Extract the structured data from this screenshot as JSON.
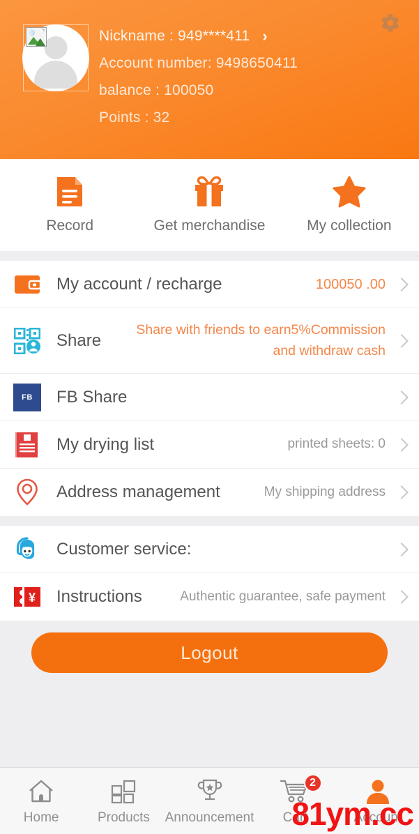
{
  "header": {
    "gear_icon": "gear-icon",
    "avatar_icon": "broken-image-placeholder",
    "nickname_label": "Nickname : 949****411",
    "chevron": "›",
    "account_label": "Account number:   9498650411",
    "balance_label": "balance : 100050",
    "points_label": "Points : 32",
    "bg_color": "#f97812"
  },
  "quick_actions": [
    {
      "icon": "document-icon",
      "label": "Record"
    },
    {
      "icon": "gift-icon",
      "label": "Get merchandise"
    },
    {
      "icon": "star-icon",
      "label": "My collection"
    }
  ],
  "menu_group_1": [
    {
      "icon": "wallet-icon",
      "label": "My account / recharge",
      "value": "100050 .00",
      "value_style": "amount"
    },
    {
      "icon": "qr-share-icon",
      "label": "Share",
      "value": "Share with friends to earn5%Commission and withdraw cash",
      "value_style": "accent"
    },
    {
      "icon": "fb-icon",
      "label": "FB Share",
      "value": "",
      "value_style": ""
    },
    {
      "icon": "receipt-icon",
      "label": "My drying list",
      "value": "printed sheets: 0",
      "value_style": ""
    },
    {
      "icon": "location-pin-icon",
      "label": "Address management",
      "value": "My shipping address",
      "value_style": ""
    }
  ],
  "menu_group_2": [
    {
      "icon": "headset-support-icon",
      "label": "Customer service:",
      "value": "",
      "value_style": ""
    },
    {
      "icon": "coupon-yen-icon",
      "label": "Instructions",
      "value": "Authentic guarantee, safe payment",
      "value_style": ""
    }
  ],
  "logout": {
    "label": "Logout"
  },
  "bottom_nav": {
    "items": [
      {
        "icon": "home-icon",
        "label": "Home",
        "badge": "",
        "active": false
      },
      {
        "icon": "grid-products-icon",
        "label": "Products",
        "badge": "",
        "active": false
      },
      {
        "icon": "trophy-icon",
        "label": "Announcement",
        "badge": "",
        "active": false
      },
      {
        "icon": "cart-icon",
        "label": "Cart",
        "badge": "2",
        "active": false
      },
      {
        "icon": "person-icon",
        "label": "Account",
        "badge": "",
        "active": true
      }
    ]
  },
  "watermark": {
    "text": "81ym.cc",
    "color": "#f01414"
  },
  "colors": {
    "accent": "#f97812",
    "badge_red": "#e8342a",
    "fb_blue": "#2d4b8e"
  }
}
